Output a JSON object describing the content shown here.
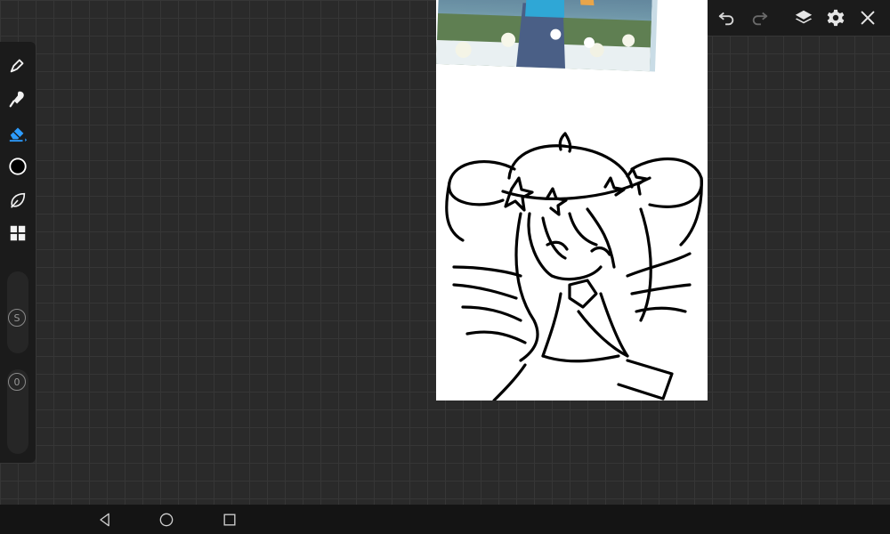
{
  "toolbar": {
    "tools": [
      {
        "name": "pen",
        "icon": "pen-icon"
      },
      {
        "name": "smudge",
        "icon": "smudge-icon"
      },
      {
        "name": "eraser",
        "icon": "eraser-icon",
        "active": true
      },
      {
        "name": "color",
        "icon": "color-swatch-icon",
        "color": "#000000"
      },
      {
        "name": "shape",
        "icon": "leaf-shape-icon"
      },
      {
        "name": "grid",
        "icon": "grid-icon"
      }
    ],
    "size_slider": {
      "label": "S"
    },
    "opacity_slider": {
      "label": "0"
    },
    "accent_color": "#2d9cff"
  },
  "actionbar": {
    "icons": [
      "undo-icon",
      "redo-icon",
      "layers-icon",
      "settings-icon",
      "close-icon"
    ]
  },
  "navbar": {
    "icons": [
      "back-icon",
      "home-icon",
      "recents-icon"
    ]
  },
  "colors": {
    "background": "#2a2a2a",
    "grid_line": "#363636",
    "panel": "#1b1b1b",
    "canvas": "#ffffff"
  }
}
